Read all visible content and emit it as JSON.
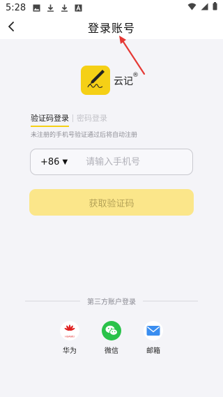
{
  "status_bar": {
    "time": "5:28",
    "left_icons": [
      "image-icon",
      "download-icon",
      "download-icon",
      "font-icon"
    ],
    "right_icons": [
      "wifi-icon",
      "signal-icon",
      "battery-icon"
    ]
  },
  "header": {
    "title": "登录账号",
    "back_icon": "chevron-left-icon"
  },
  "annotation": {
    "color": "#e53935"
  },
  "app": {
    "name": "云记",
    "registered_mark": "®",
    "brand_color": "#f5d016"
  },
  "tabs": [
    {
      "label": "验证码登录",
      "active": true
    },
    {
      "label": "密码登录",
      "active": false
    }
  ],
  "hint": "未注册的手机号验证通过后将自动注册",
  "phone": {
    "country_code": "+86",
    "value": "",
    "placeholder": "请输入手机号"
  },
  "get_code_button": "获取验证码",
  "third_party": {
    "title": "第三方账户登录",
    "providers": [
      {
        "label": "华为",
        "icon": "huawei-icon",
        "logo_text": "HUAWEI"
      },
      {
        "label": "微信",
        "icon": "wechat-icon"
      },
      {
        "label": "邮箱",
        "icon": "mail-icon"
      }
    ]
  }
}
